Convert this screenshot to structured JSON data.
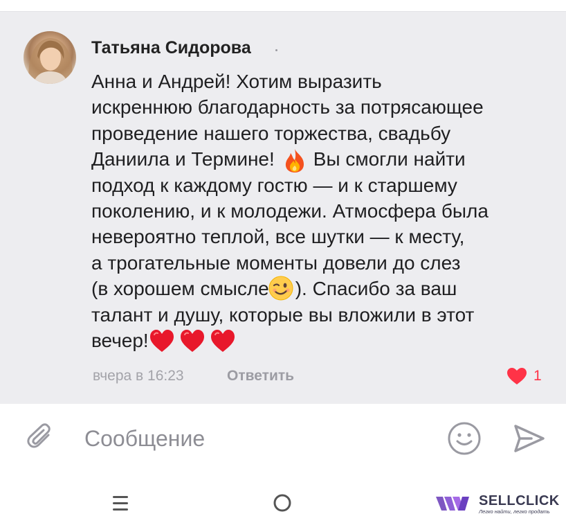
{
  "comment": {
    "author": "Татьяна Сидорова",
    "lines": {
      "l1": "Анна и Андрей! Хотим выразить",
      "l2": "искреннюю благодарность за потрясающее",
      "l3": "проведение нашего торжества, свадьбу",
      "l4a": "Даниила и Термине!",
      "l4b": "Вы смогли найти",
      "l5": "подход к каждому гостю — и к старшему",
      "l6": "поколению, и к молодежи. Атмосфера была",
      "l7": "невероятно теплой, все шутки — к месту,",
      "l8": "а трогательные моменты довели до слез",
      "l9a": "(в хорошем смысле",
      "l9b": "). Спасибо за ваш",
      "l10": "талант и душу, которые вы вложили в этот",
      "l11": "вечер!"
    },
    "emojis": [
      "fire",
      "winking-face",
      "red-heart",
      "red-heart",
      "red-heart"
    ],
    "timestamp": "вчера в 16:23",
    "reply_label": "Ответить",
    "likes": "1",
    "like_color": "#ff3347"
  },
  "composer": {
    "placeholder": "Сообщение"
  },
  "watermark": {
    "brand": "SELLCLICK",
    "tagline": "Легко найти, легко продать"
  },
  "colors": {
    "card_background": "#ededf0",
    "accent_like": "#ff3347",
    "icon_gray": "#8d8d94"
  }
}
